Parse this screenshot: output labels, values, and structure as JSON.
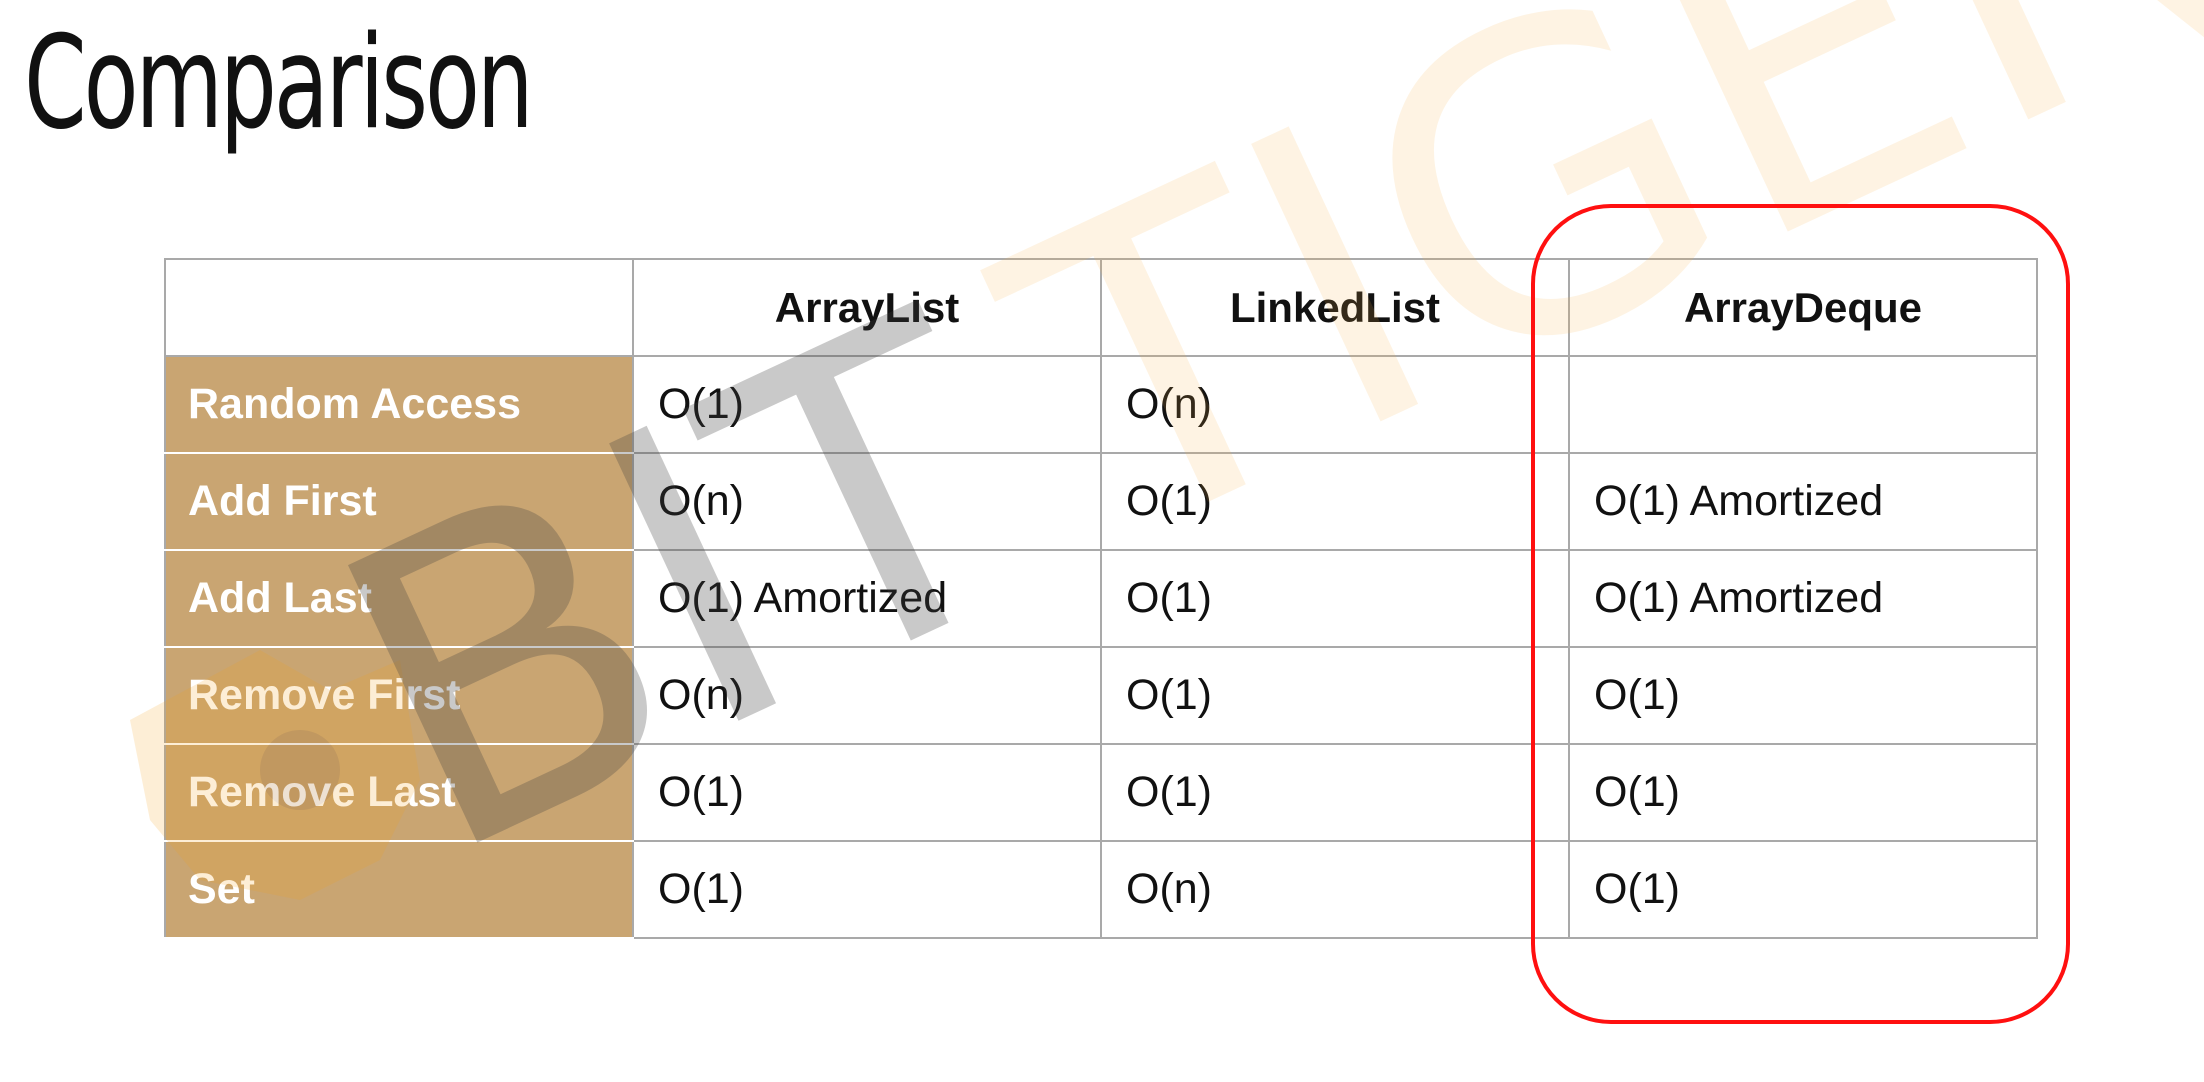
{
  "title": "Comparison",
  "watermark_text": "BITTIGER",
  "table": {
    "columns": [
      "",
      "ArrayList",
      "LinkedList",
      "ArrayDeque"
    ],
    "rows": [
      {
        "label": "Random Access",
        "cells": [
          "O(1)",
          "O(n)",
          ""
        ]
      },
      {
        "label": "Add First",
        "cells": [
          "O(n)",
          "O(1)",
          "O(1) Amortized"
        ]
      },
      {
        "label": "Add Last",
        "cells": [
          "O(1) Amortized",
          "O(1)",
          "O(1) Amortized"
        ]
      },
      {
        "label": "Remove First",
        "cells": [
          "O(n)",
          "O(1)",
          "O(1)"
        ]
      },
      {
        "label": "Remove Last",
        "cells": [
          "O(1)",
          "O(1)",
          "O(1)"
        ]
      },
      {
        "label": "Set",
        "cells": [
          "O(1)",
          "O(n)",
          "O(1)"
        ]
      }
    ]
  },
  "colors": {
    "row_label_bg": "#c9a572",
    "highlight": "#ff1010",
    "grid": "#a9a9a9"
  }
}
